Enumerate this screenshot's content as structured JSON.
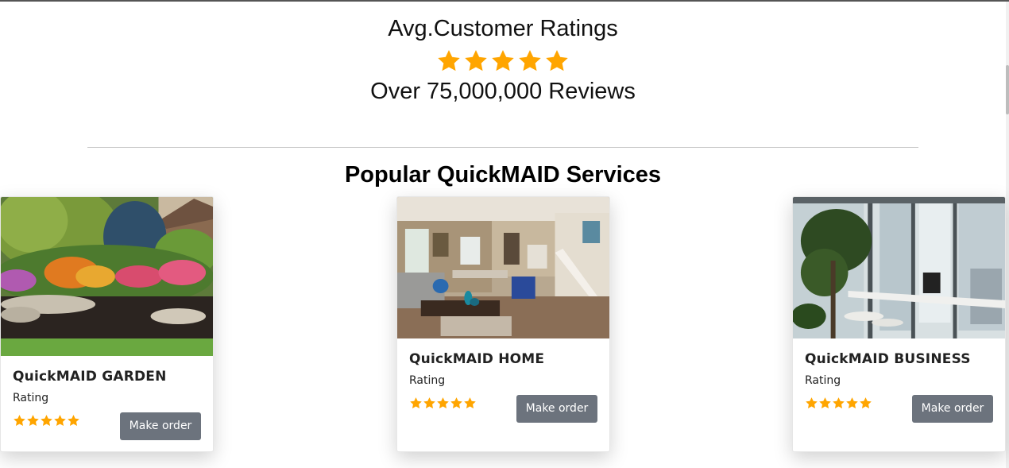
{
  "ratings": {
    "title": "Avg.Customer Ratings",
    "stars": 5,
    "reviews": "Over 75,000,000 Reviews"
  },
  "services": {
    "title": "Popular QuickMAID Services",
    "cards": [
      {
        "title": "QuickMAID GARDEN",
        "rating_label": "Rating",
        "stars": 5,
        "button_label": "Make order",
        "image": "garden-photo"
      },
      {
        "title": "QuickMAID HOME",
        "rating_label": "Rating",
        "stars": 5,
        "button_label": "Make order",
        "image": "living-room-photo"
      },
      {
        "title": "QuickMAID BUSINESS",
        "rating_label": "Rating",
        "stars": 5,
        "button_label": "Make order",
        "image": "office-photo"
      }
    ]
  },
  "colors": {
    "star": "#FFA500",
    "button": "#6c737d"
  }
}
